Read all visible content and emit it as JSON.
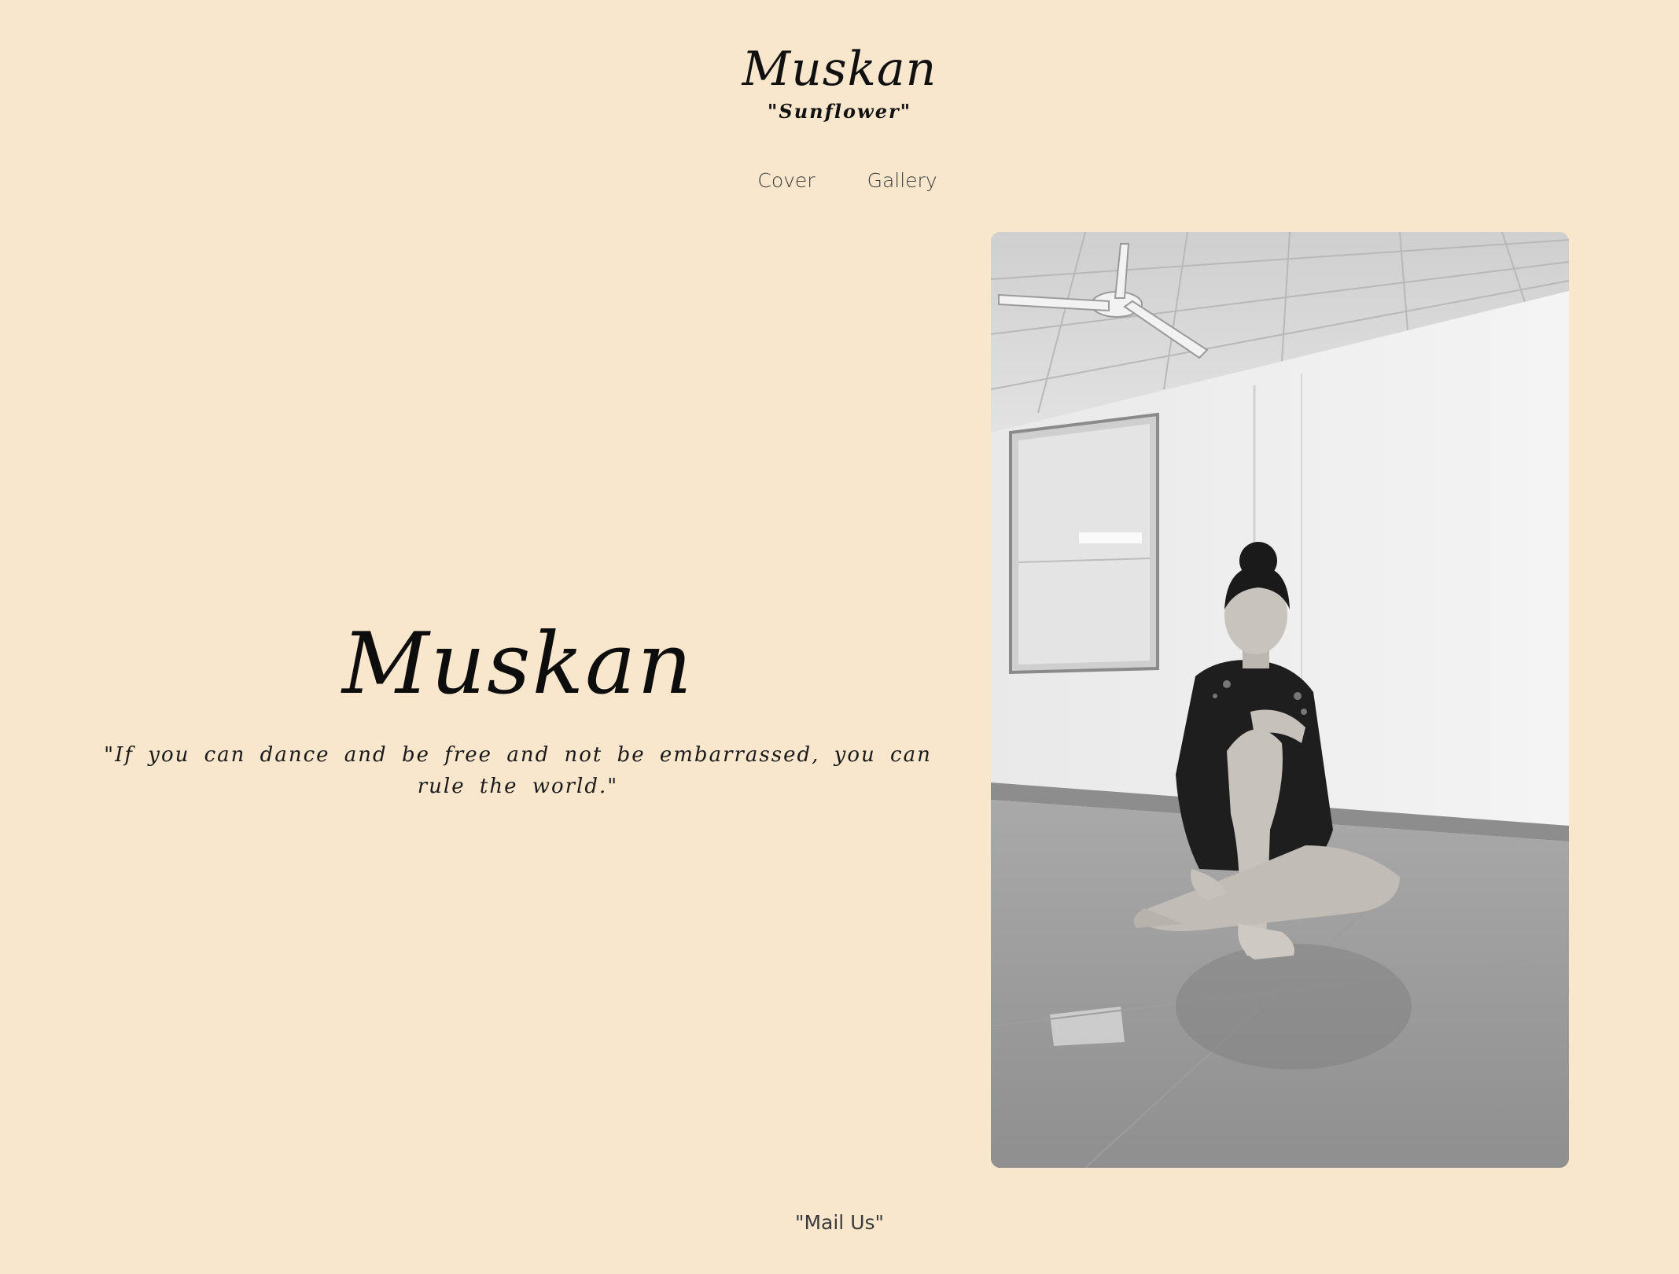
{
  "header": {
    "site_title": "Muskan",
    "tagline": "\"Sunflower\""
  },
  "nav": {
    "items": [
      {
        "label": "Cover"
      },
      {
        "label": "Gallery"
      }
    ]
  },
  "hero": {
    "name": "Muskan",
    "quote": "\"If you can dance and be free and not be embarrassed, you can rule the world.\""
  },
  "footer": {
    "mail_label": "\"Mail Us\""
  },
  "colors": {
    "background": "#f8e6cd",
    "text": "#1a1a1a"
  }
}
